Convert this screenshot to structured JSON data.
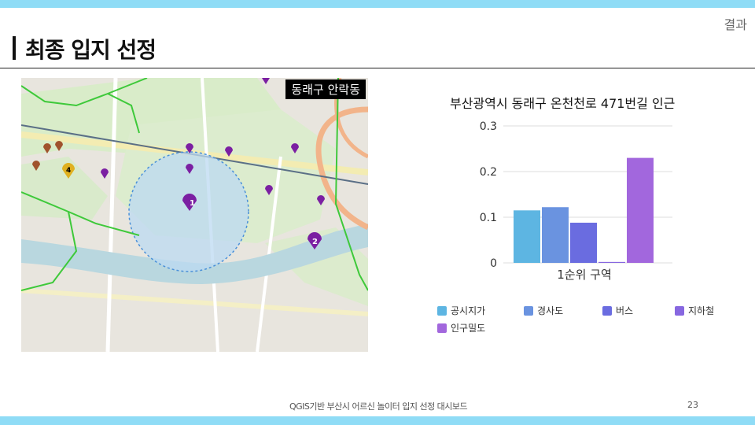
{
  "header": {
    "section_label": "결과",
    "title": "최종 입지 선정"
  },
  "map": {
    "label": "동래구 안락동",
    "markers": [
      "1",
      "2",
      "4"
    ],
    "colors": {
      "water": "#b9d7df",
      "buffer": "#bcd9f2",
      "route": "#3ec93a",
      "marker": "#7b1fa2"
    }
  },
  "chart_data": {
    "type": "bar",
    "title": "부산광역시 동래구 온천천로 471번길 인근",
    "categories": [
      "1순위 구역"
    ],
    "series": [
      {
        "name": "공시지가",
        "values": [
          0.115
        ],
        "color": "#5db5e2"
      },
      {
        "name": "경사도",
        "values": [
          0.122
        ],
        "color": "#6a93e0"
      },
      {
        "name": "버스",
        "values": [
          0.088
        ],
        "color": "#6a6ce0"
      },
      {
        "name": "지하철",
        "values": [
          0.002
        ],
        "color": "#8767e0"
      },
      {
        "name": "인구밀도",
        "values": [
          0.23
        ],
        "color": "#a267dd"
      }
    ],
    "ylim": [
      0,
      0.3
    ],
    "yticks": [
      "0",
      "0.1",
      "0.2",
      "0.3"
    ],
    "grid": true,
    "legend_position": "bottom"
  },
  "footer": {
    "text": "QGIS기반 부산시 어르신 놀이터 입지 선정 대시보드",
    "page": "23"
  }
}
